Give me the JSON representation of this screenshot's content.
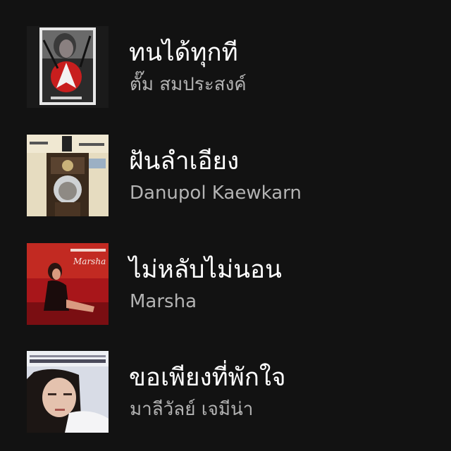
{
  "tracks": [
    {
      "title": "ทนได้ทุกที",
      "artist": "ตั๊ม สมประสงค์",
      "cover": "album-cover-red-arrow"
    },
    {
      "title": "ฝันลำเอียง",
      "artist": "Danupol Kaewkarn",
      "cover": "album-cover-clock-tower"
    },
    {
      "title": "ไม่หลับไม่นอน",
      "artist": "Marsha",
      "cover": "album-cover-red-room"
    },
    {
      "title": "ขอเพียงที่พักใจ",
      "artist": "มาลีวัลย์ เจมีน่า",
      "cover": "album-cover-portrait"
    }
  ],
  "colors": {
    "background": "#121212",
    "title": "#ffffff",
    "artist": "#b3b3b3"
  }
}
